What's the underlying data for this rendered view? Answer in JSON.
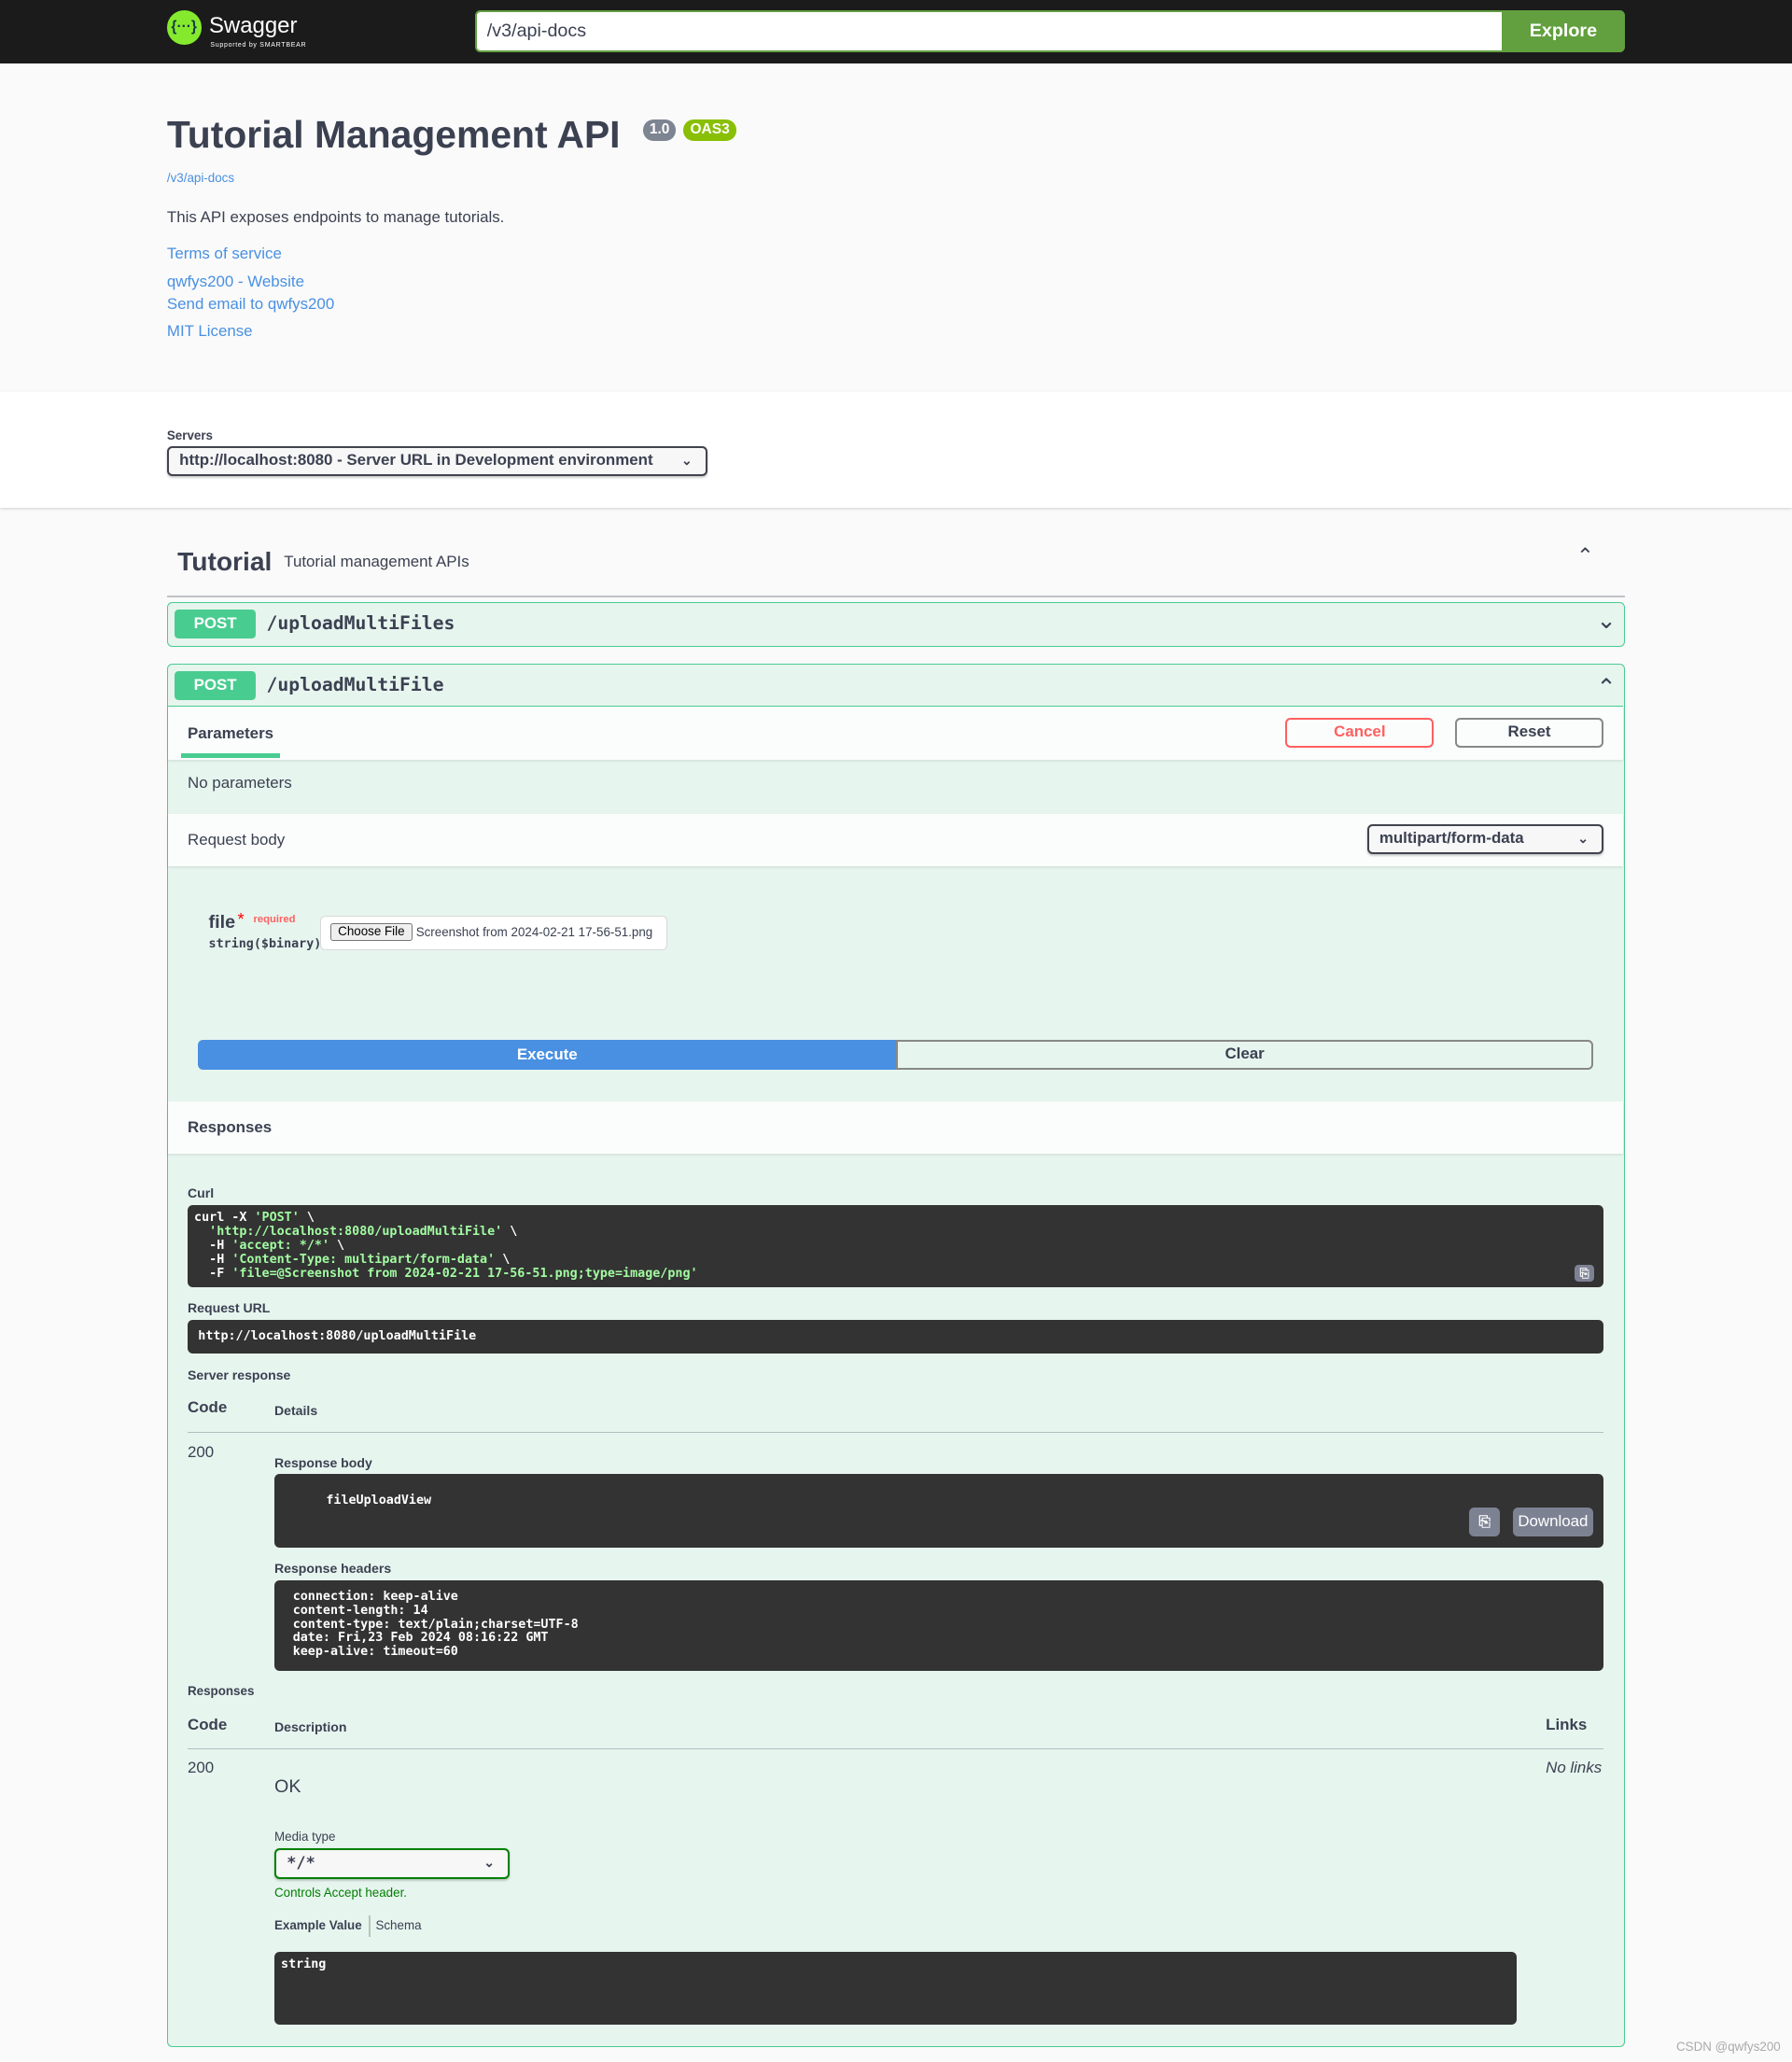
{
  "topbar": {
    "logo_text": "Swagger",
    "logo_sub": "Supported by SMARTBEAR",
    "url_value": "/v3/api-docs",
    "explore_label": "Explore"
  },
  "info": {
    "title": "Tutorial Management API",
    "version": "1.0",
    "oas": "OAS3",
    "spec_url": "/v3/api-docs",
    "description": "This API exposes endpoints to manage tutorials.",
    "links": [
      "Terms of service",
      "qwfys200 - Website",
      "Send email to qwfys200",
      "MIT License"
    ]
  },
  "servers": {
    "label": "Servers",
    "selected": "http://localhost:8080 - Server URL in Development environment"
  },
  "tag": {
    "name": "Tutorial",
    "description": "Tutorial management APIs"
  },
  "operations": [
    {
      "method": "POST",
      "path": "/uploadMultiFiles",
      "expanded": false
    },
    {
      "method": "POST",
      "path": "/uploadMultiFile",
      "expanded": true
    }
  ],
  "op_detail": {
    "params_tab": "Parameters",
    "cancel_label": "Cancel",
    "reset_label": "Reset",
    "no_params": "No parameters",
    "request_body_label": "Request body",
    "content_type": "multipart/form-data",
    "file_field": {
      "name": "file",
      "required_star": "*",
      "required": "required",
      "type": "string($binary)",
      "choose_label": "Choose File",
      "file_name": "Screenshot from 2024-02-21 17-56-51.png"
    },
    "execute_label": "Execute",
    "clear_label": "Clear",
    "responses_heading": "Responses",
    "curl_label": "Curl",
    "curl_lines": [
      {
        "cmd": "curl -X ",
        "str": "'POST'",
        "tail": " \\"
      },
      {
        "cmd": "  ",
        "str": "'http://localhost:8080/uploadMultiFile'",
        "tail": " \\"
      },
      {
        "cmd": "  -H ",
        "str": "'accept: */*'",
        "tail": " \\"
      },
      {
        "cmd": "  -H ",
        "str": "'Content-Type: multipart/form-data'",
        "tail": " \\"
      },
      {
        "cmd": "  -F ",
        "str": "'file=@Screenshot from 2024-02-21 17-56-51.png;type=image/png'",
        "tail": ""
      }
    ],
    "request_url_label": "Request URL",
    "request_url": "http://localhost:8080/uploadMultiFile",
    "server_response_label": "Server response",
    "col_code": "Code",
    "col_details": "Details",
    "status_code": "200",
    "response_body_label": "Response body",
    "response_body": "fileUploadView",
    "download_label": "Download",
    "response_headers_label": "Response headers",
    "response_headers": "connection: keep-alive\ncontent-length: 14\ncontent-type: text/plain;charset=UTF-8\ndate: Fri,23 Feb 2024 08:16:22 GMT\nkeep-alive: timeout=60",
    "responses_label": "Responses",
    "col_description": "Description",
    "col_links": "Links",
    "resp_code": "200",
    "resp_desc": "OK",
    "no_links": "No links",
    "media_type_label": "Media type",
    "media_type": "*/*",
    "controls_accept": "Controls Accept header.",
    "example_tab": "Example Value",
    "schema_tab": "Schema",
    "example_value": "string"
  },
  "watermark": "CSDN @qwfys200",
  "colors": {
    "post": "#49cc90",
    "execute": "#4990e2",
    "explore": "#62a03f",
    "cancel": "#ff6060",
    "logo": "#85ea2d"
  }
}
